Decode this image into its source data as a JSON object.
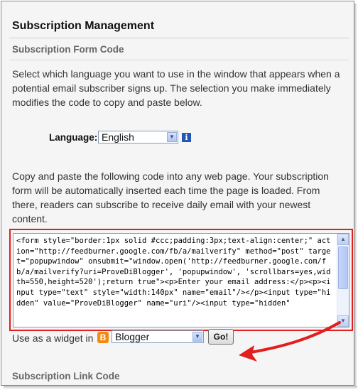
{
  "header": {
    "title": "Subscription Management",
    "subtitle": "Subscription Form Code"
  },
  "intro_text": "Select which language you want to use in the window that appears when a potential email subscriber signs up. The selection you make immediately modifies the code to copy and paste below.",
  "language": {
    "label": "Language:",
    "selected": "English",
    "info_icon_glyph": "i"
  },
  "instructions": "Copy and paste the following code into any web page. Your subscription form will be automatically inserted each time the page is loaded. From there, readers can subscribe to receive daily email with your newest content.",
  "code_snippet": "<form style=\"border:1px solid #ccc;padding:3px;text-align:center;\" action=\"http://feedburner.google.com/fb/a/mailverify\" method=\"post\" target=\"popupwindow\" onsubmit=\"window.open('http://feedburner.google.com/fb/a/mailverify?uri=ProveDiBlogger', 'popupwindow', 'scrollbars=yes,width=550,height=520');return true\"><p>Enter your email address:</p><p><input type=\"text\" style=\"width:140px\" name=\"email\"/></p><input type=\"hidden\" value=\"ProveDiBlogger\" name=\"uri\"/><input type=\"hidden\"",
  "widget": {
    "label": "Use as a widget in",
    "icon_glyph": "B",
    "selected": "Blogger",
    "go_label": "Go!"
  },
  "next_section": "Subscription Link Code",
  "colors": {
    "highlight_red": "#e21f1f",
    "blogger_orange": "#f28a12",
    "info_blue": "#2456b7"
  }
}
